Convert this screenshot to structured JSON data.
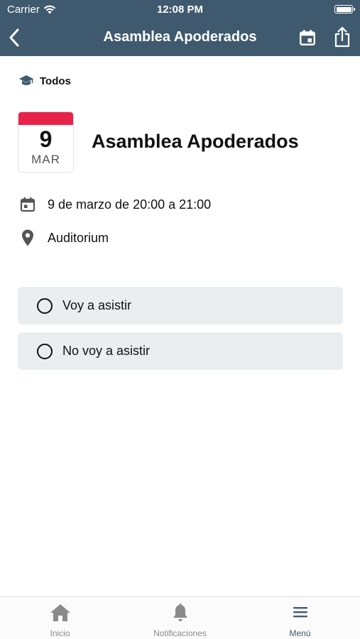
{
  "status_bar": {
    "carrier": "Carrier",
    "time": "12:08 PM"
  },
  "nav": {
    "title": "Asamblea Apoderados",
    "back_icon": "chevron-left-icon",
    "calendar_icon": "calendar-add-icon",
    "share_icon": "share-icon"
  },
  "audience": {
    "icon": "graduation-cap-icon",
    "label": "Todos"
  },
  "event": {
    "day": "9",
    "month": "MAR",
    "title": "Asamblea Apoderados",
    "date_text": "9 de marzo de 20:00 a 21:00",
    "location": "Auditorium"
  },
  "rsvp": {
    "options": [
      {
        "label": "Voy a asistir",
        "selected": false
      },
      {
        "label": "No voy a asistir",
        "selected": false
      }
    ]
  },
  "tabbar": {
    "items": [
      {
        "label": "Inicio",
        "icon": "home-icon",
        "active": false
      },
      {
        "label": "Notificaciones",
        "icon": "bell-icon",
        "active": false
      },
      {
        "label": "Menú",
        "icon": "menu-icon",
        "active": true
      }
    ]
  },
  "colors": {
    "header": "#3f5a6e",
    "date_accent": "#e8234b",
    "option_bg": "#eaeef1"
  }
}
